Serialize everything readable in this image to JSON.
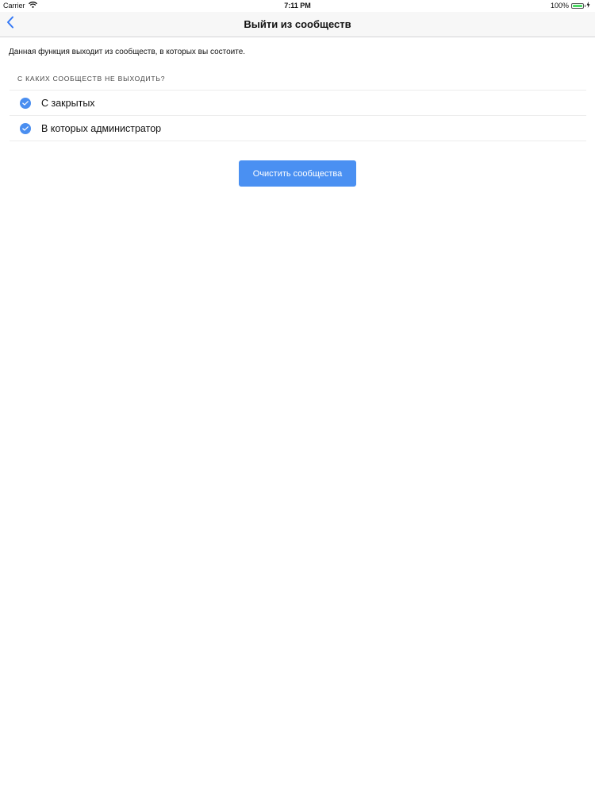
{
  "status_bar": {
    "carrier": "Carrier",
    "time": "7:11 PM",
    "battery": "100%",
    "wifi_icon": "wifi-icon",
    "battery_icon": "battery-icon",
    "charging_icon": "charging-bolt-icon"
  },
  "nav": {
    "back_icon": "chevron-left-icon",
    "title": "Выйти из сообществ"
  },
  "content": {
    "description": "Данная функция выходит из сообществ, в которых вы состоите.",
    "section_header": "С КАКИХ СООБЩЕСТВ НЕ ВЫХОДИТЬ?",
    "options": [
      {
        "label": "С закрытых",
        "checked": true
      },
      {
        "label": "В которых администратор",
        "checked": true
      }
    ],
    "action_button": "Очистить сообщества"
  },
  "colors": {
    "accent": "#4a90f2",
    "nav_background": "#f7f7f7",
    "battery_fill": "#4cd964"
  }
}
